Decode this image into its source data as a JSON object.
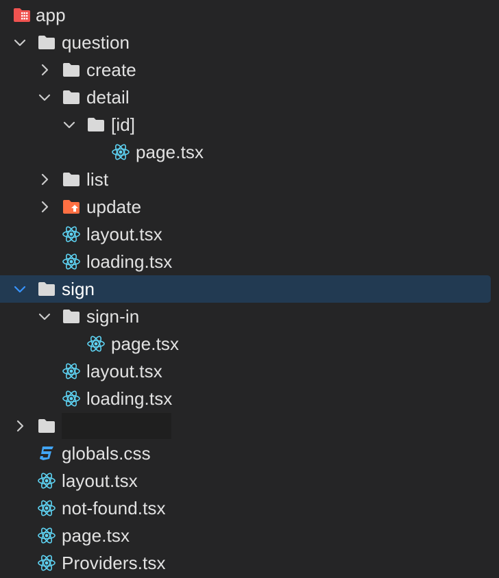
{
  "tree": {
    "root_label": "app",
    "items": [
      {
        "label": "question"
      },
      {
        "label": "create"
      },
      {
        "label": "detail"
      },
      {
        "label": "[id]"
      },
      {
        "label": "page.tsx"
      },
      {
        "label": "list"
      },
      {
        "label": "update"
      },
      {
        "label": "layout.tsx"
      },
      {
        "label": "loading.tsx"
      },
      {
        "label": "sign"
      },
      {
        "label": "sign-in"
      },
      {
        "label": "page.tsx"
      },
      {
        "label": "layout.tsx"
      },
      {
        "label": "loading.tsx"
      },
      {
        "label": ""
      },
      {
        "label": "globals.css"
      },
      {
        "label": "layout.tsx"
      },
      {
        "label": "not-found.tsx"
      },
      {
        "label": "page.tsx"
      },
      {
        "label": "Providers.tsx"
      }
    ]
  },
  "colors": {
    "background": "#252526",
    "selection": "#223a52",
    "folder": "#d9d9d9",
    "react": "#5ed3f3",
    "css": "#42a5f5",
    "app_folder": "#ef5350",
    "update_folder": "#ff7043",
    "chevron": "#cccccc",
    "chevron_selected": "#3794ff"
  }
}
